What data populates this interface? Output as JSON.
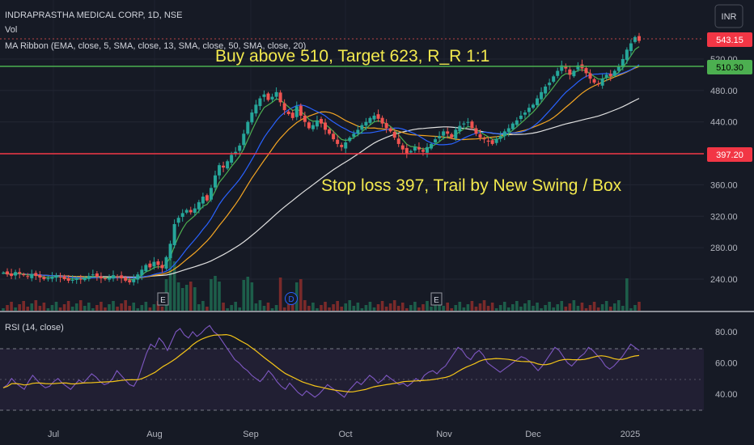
{
  "header": {
    "title": "INDRAPRASTHA MEDICAL CORP, 1D, NSE",
    "vol_label": "Vol",
    "ma_ribbon_label": "MA Ribbon (EMA, close, 5, SMA, close, 13, SMA, close, 50, SMA, close, 20)",
    "currency_button": "INR"
  },
  "annotations": {
    "buy_text": "Buy above 510, Target 623, R_R 1:1",
    "stop_text": "Stop loss 397, Trail by New Swing / Box"
  },
  "price_badges": {
    "current": "543.15",
    "buy_level": "510.30",
    "stop_level": "397.20"
  },
  "rsi": {
    "label": "RSI (14, close)"
  },
  "event_markers": [
    {
      "label": "E",
      "date": "Aug"
    },
    {
      "label": "D",
      "date": "Oct"
    },
    {
      "label": "E",
      "date": "Nov"
    }
  ],
  "colors": {
    "background": "#161a25",
    "up": "#26a69a",
    "down": "#ef5350",
    "ema5": "#4caf50",
    "sma13": "#2962ff",
    "sma20": "#f5a623",
    "sma50": "#e0e0e0",
    "annotation_text": "#f2e94e",
    "buy_line": "#4caf50",
    "stop_line": "#f23645",
    "rsi_line": "#7e57c2",
    "rsi_ma": "#f5c518"
  },
  "chart_data": [
    {
      "type": "candlestick",
      "title": "INDRAPRASTHA MEDICAL CORP, 1D, NSE",
      "x_tick_labels": [
        "Jul",
        "Aug",
        "Sep",
        "Oct",
        "Nov",
        "Dec",
        "2025"
      ],
      "y_tick_labels": [
        "240.00",
        "280.00",
        "320.00",
        "360.00",
        "400.00",
        "440.00",
        "480.00",
        "520.00"
      ],
      "ylim": [
        215,
        560
      ],
      "horizontal_lines": [
        {
          "value": 510.3,
          "label": "510.30"
        },
        {
          "value": 397.2,
          "label": "397.20"
        }
      ],
      "last_price": 543.15,
      "close_series": [
        248,
        246,
        244,
        249,
        247,
        245,
        243,
        246,
        244,
        242,
        240,
        241,
        243,
        245,
        242,
        240,
        238,
        239,
        241,
        240,
        242,
        244,
        246,
        243,
        241,
        240,
        242,
        245,
        243,
        241,
        238,
        236,
        240,
        246,
        252,
        258,
        255,
        262,
        258,
        254,
        268,
        285,
        310,
        318,
        324,
        328,
        325,
        330,
        338,
        345,
        340,
        356,
        372,
        385,
        382,
        390,
        398,
        402,
        410,
        425,
        440,
        452,
        462,
        470,
        475,
        468,
        472,
        478,
        465,
        455,
        450,
        445,
        460,
        448,
        440,
        432,
        436,
        442,
        438,
        430,
        425,
        418,
        412,
        408,
        414,
        420,
        425,
        430,
        436,
        440,
        445,
        448,
        444,
        438,
        432,
        428,
        420,
        412,
        405,
        400,
        403,
        408,
        405,
        402,
        408,
        412,
        418,
        422,
        428,
        425,
        420,
        430,
        435,
        438,
        440,
        432,
        425,
        420,
        418,
        415,
        412,
        418,
        422,
        428,
        432,
        438,
        442,
        448,
        452,
        458,
        462,
        470,
        478,
        485,
        490,
        498,
        505,
        512,
        508,
        500,
        505,
        512,
        508,
        502,
        495,
        490,
        488,
        495,
        500,
        498,
        505,
        510,
        520,
        532,
        540,
        548,
        543.15
      ],
      "ma_ribbon": [
        "EMA 5",
        "SMA 13",
        "SMA 20",
        "SMA 50"
      ],
      "volume": "bars along bottom of price pane"
    },
    {
      "type": "line",
      "title": "RSI (14, close)",
      "y_tick_labels": [
        "40.00",
        "60.00",
        "80.00"
      ],
      "ylim": [
        30,
        85
      ],
      "bands": [
        30,
        50,
        70
      ],
      "series": [
        {
          "values": [
            44,
            46,
            50,
            47,
            45,
            43,
            48,
            52,
            49,
            46,
            44,
            45,
            48,
            50,
            47,
            45,
            43,
            46,
            49,
            47,
            50,
            53,
            51,
            48,
            46,
            47,
            50,
            55,
            52,
            49,
            46,
            45,
            50,
            58,
            66,
            72,
            70,
            76,
            73,
            68,
            74,
            80,
            82,
            78,
            76,
            80,
            77,
            79,
            82,
            84,
            80,
            78,
            74,
            70,
            66,
            62,
            60,
            57,
            55,
            52,
            50,
            48,
            51,
            55,
            52,
            48,
            45,
            43,
            47,
            44,
            41,
            39,
            42,
            40,
            38,
            40,
            43,
            46,
            44,
            42,
            40,
            38,
            42,
            45,
            48,
            46,
            49,
            52,
            50,
            47,
            49,
            52,
            50,
            48,
            46,
            47,
            45,
            47,
            50,
            48,
            52,
            54,
            55,
            53,
            56,
            58,
            62,
            66,
            70,
            68,
            64,
            62,
            66,
            68,
            65,
            60,
            58,
            56,
            54,
            56,
            58,
            60,
            62,
            64,
            63,
            61,
            58,
            55,
            58,
            62,
            66,
            70,
            68,
            64,
            60,
            58,
            61,
            64,
            66,
            70,
            68,
            65,
            62,
            58,
            56,
            58,
            61,
            64,
            68,
            72,
            70,
            68
          ]
        }
      ]
    }
  ]
}
